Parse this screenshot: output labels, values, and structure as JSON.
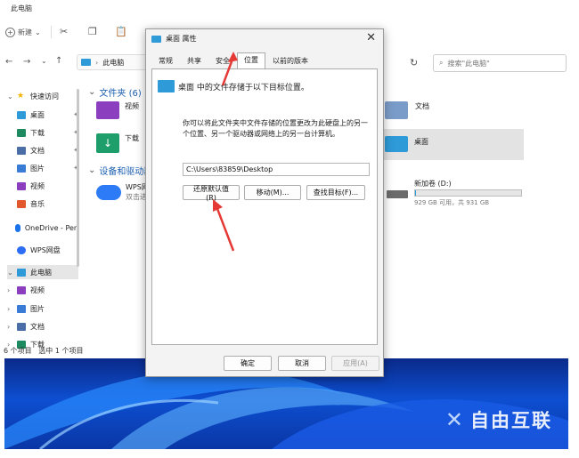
{
  "explorer": {
    "title": "此电脑",
    "toolbar": {
      "new_label": "新建"
    },
    "address": "此电脑",
    "search_placeholder": "搜索\"此电脑\"",
    "sidebar": [
      {
        "label": "快速访问",
        "icon": "star-icon",
        "color": "#f2b400"
      },
      {
        "label": "桌面",
        "icon": "desktop-icon",
        "color": "#2f9ad8",
        "pinned": true
      },
      {
        "label": "下载",
        "icon": "download-icon",
        "color": "#1e8a5f",
        "pinned": true
      },
      {
        "label": "文档",
        "icon": "document-icon",
        "color": "#4b6ea8",
        "pinned": true
      },
      {
        "label": "图片",
        "icon": "pictures-icon",
        "color": "#3a7bd5",
        "pinned": true
      },
      {
        "label": "视频",
        "icon": "video-icon",
        "color": "#8b3fbf"
      },
      {
        "label": "音乐",
        "icon": "music-icon",
        "color": "#e2572b"
      },
      {
        "label": "OneDrive - Pen",
        "icon": "cloud-icon",
        "color": "#1a73e8"
      },
      {
        "label": "WPS网盘",
        "icon": "wps-cloud-icon",
        "color": "#2d6df6"
      },
      {
        "label": "此电脑",
        "icon": "computer-icon",
        "color": "#2f9ad8"
      },
      {
        "label": "视频",
        "icon": "video-icon",
        "color": "#8b3fbf"
      },
      {
        "label": "图片",
        "icon": "pictures-icon",
        "color": "#3a7bd5"
      },
      {
        "label": "文档",
        "icon": "document-icon",
        "color": "#4b6ea8"
      },
      {
        "label": "下载",
        "icon": "download-icon",
        "color": "#1e8a5f"
      }
    ],
    "folders_section": "文件夹 (6)",
    "devices_section": "设备和驱动器",
    "folders": {
      "video": "视频",
      "download": "下载",
      "documents": "文档",
      "desktop": "桌面"
    },
    "wps": {
      "name": "WPS网",
      "sub": "双击进"
    },
    "drive": {
      "name": "新加卷 (D:)",
      "space": "929 GB 可用，共 931 GB",
      "used_fraction": 0.002
    },
    "status": {
      "items": "6 个项目",
      "selected": "选中 1 个项目"
    }
  },
  "dialog": {
    "title": "桌面 属性",
    "tabs": [
      "常规",
      "共享",
      "安全",
      "位置",
      "以前的版本"
    ],
    "active_tab": "位置",
    "heading": "桌面 中的文件存储于以下目标位置。",
    "description": "你可以将此文件夹中文件存储的位置更改为此硬盘上的另一个位置、另一个驱动器或网络上的另一台计算机。",
    "path": "C:\\Users\\83859\\Desktop",
    "buttons": {
      "restore": "还原默认值(R)",
      "move": "移动(M)...",
      "find": "查找目标(F)..."
    },
    "footer": {
      "ok": "确定",
      "cancel": "取消",
      "apply": "应用(A)"
    }
  },
  "watermark": "自由互联",
  "colors": {
    "accent": "#1b5fb0",
    "annotation_arrow": "#e53935"
  }
}
